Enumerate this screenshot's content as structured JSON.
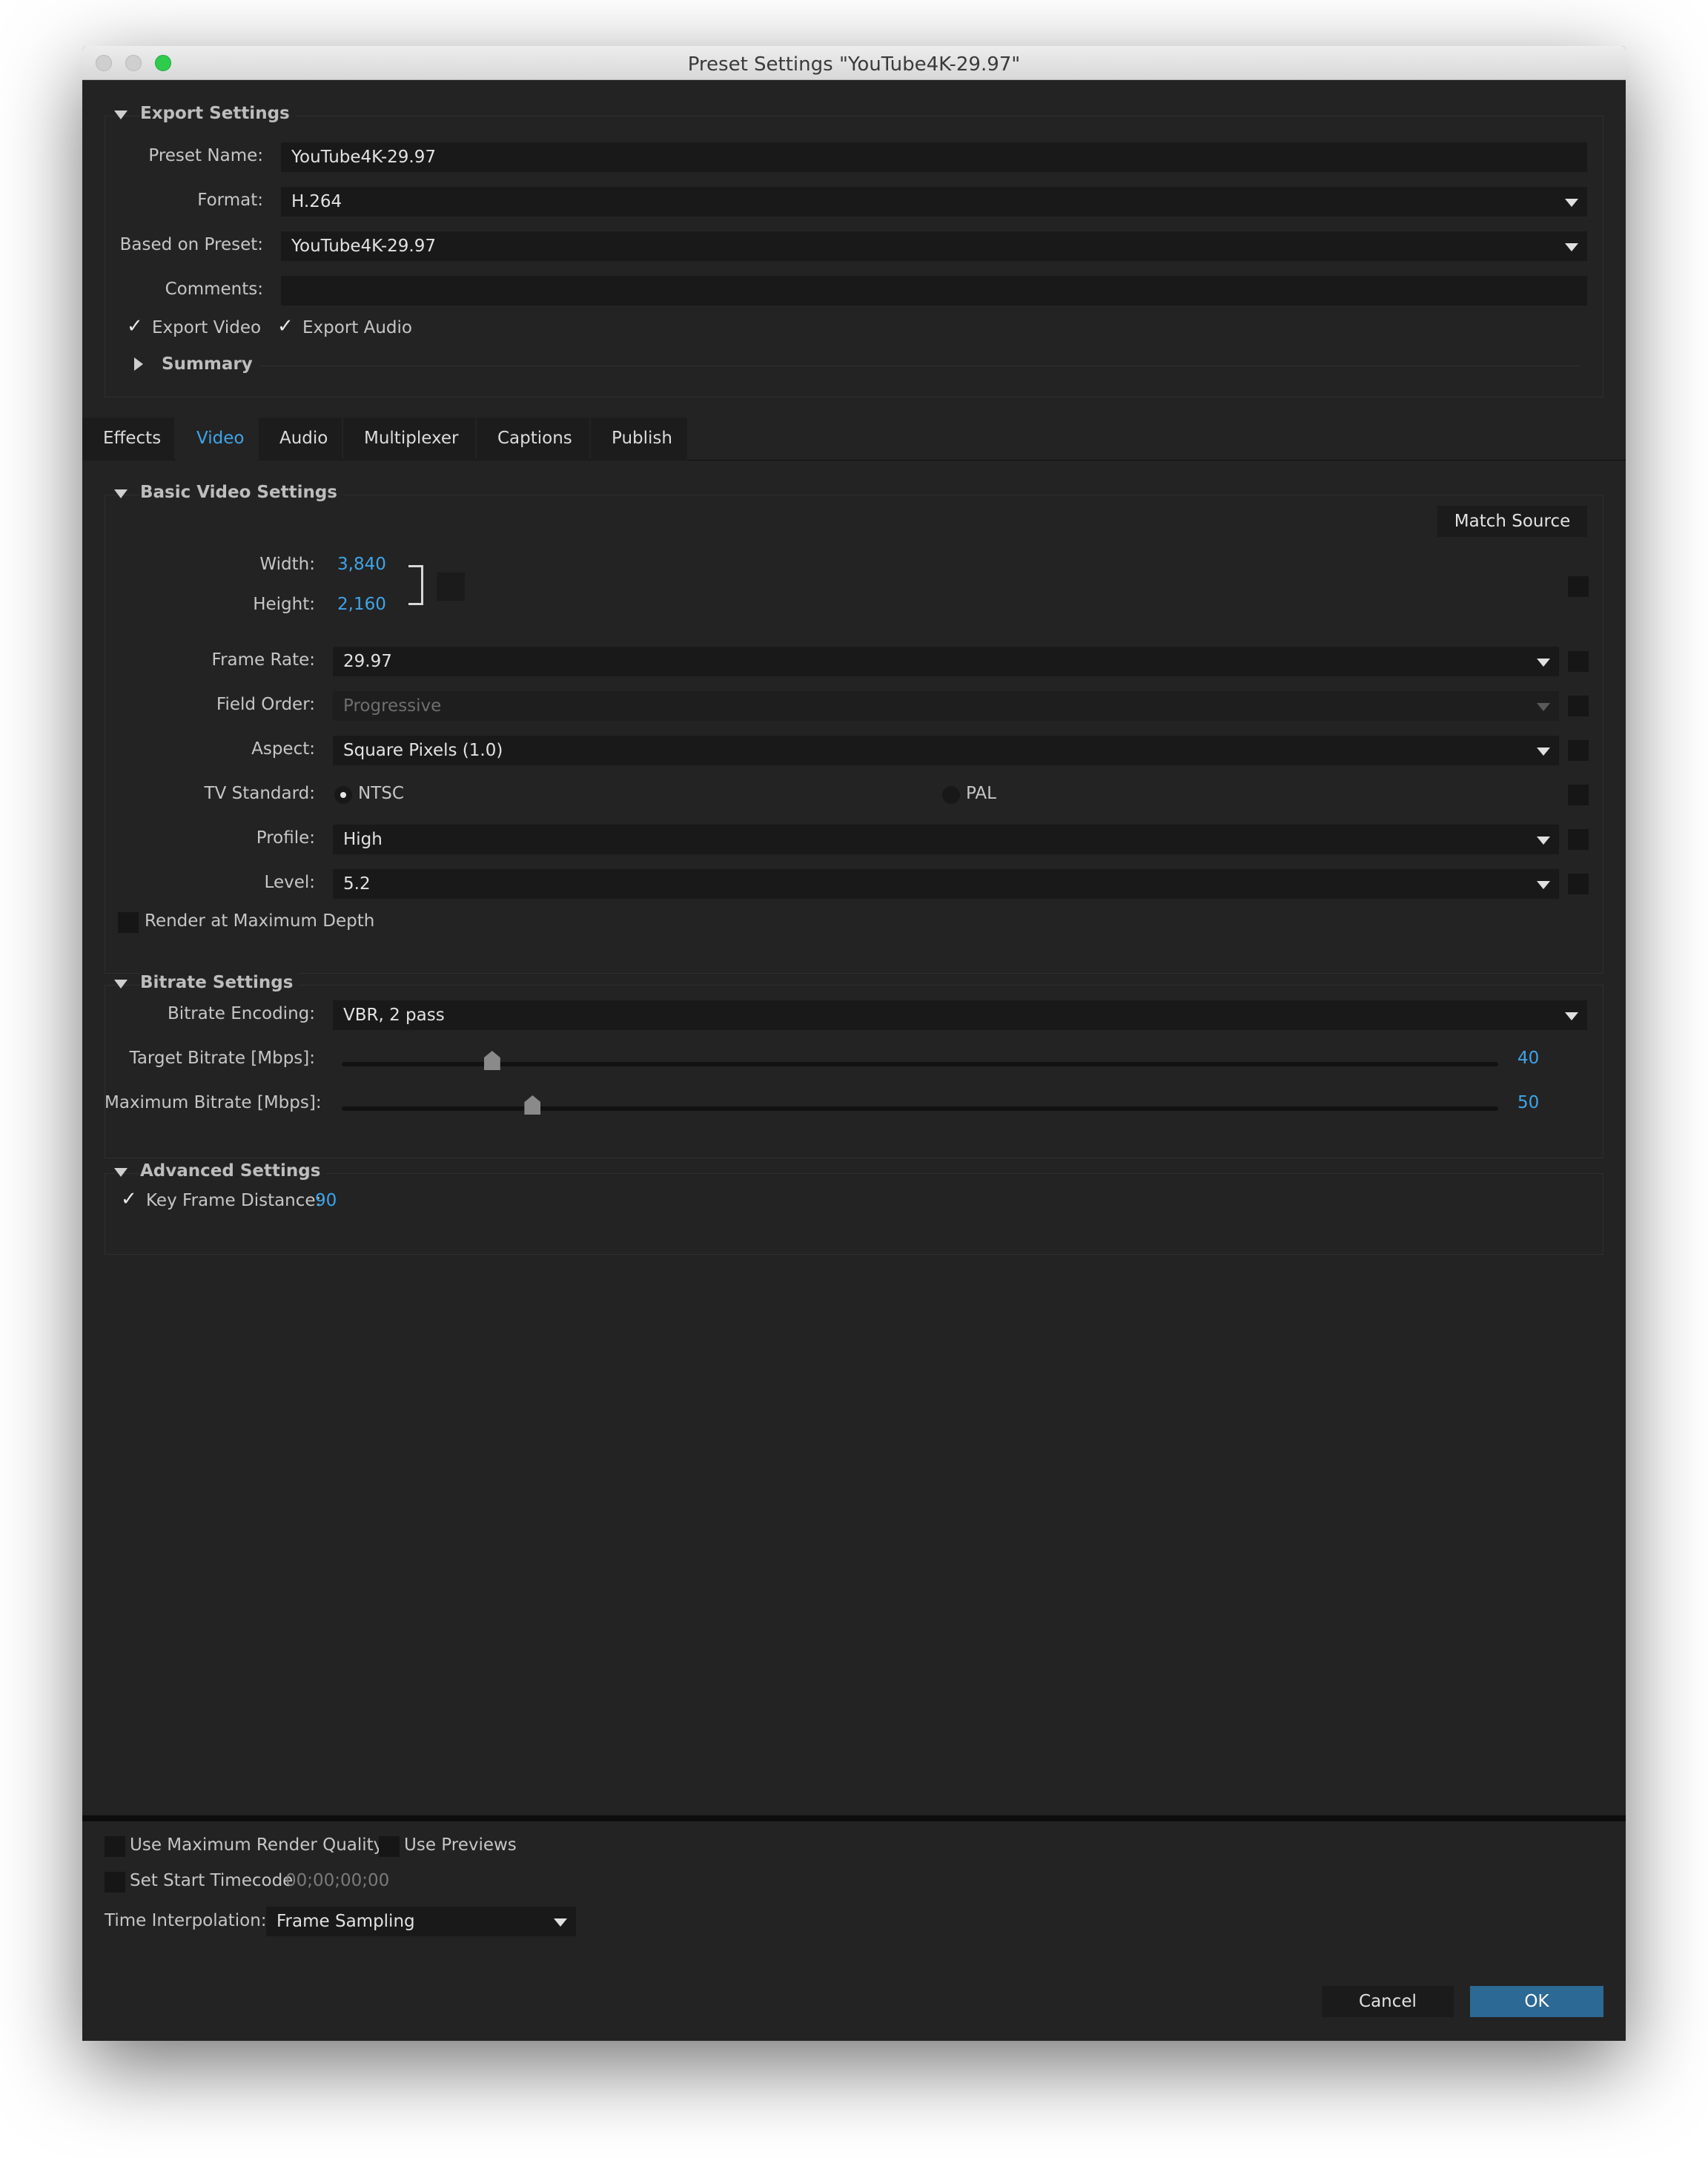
{
  "window": {
    "title": "Preset Settings \"YouTube4K-29.97\""
  },
  "export_settings": {
    "title": "Export Settings",
    "preset_name_label": "Preset Name:",
    "preset_name_value": "YouTube4K-29.97",
    "format_label": "Format:",
    "format_value": "H.264",
    "based_on_label": "Based on Preset:",
    "based_on_value": "YouTube4K-29.97",
    "comments_label": "Comments:",
    "comments_value": "",
    "export_video_label": "Export Video",
    "export_video_checked": true,
    "export_audio_label": "Export Audio",
    "export_audio_checked": true,
    "summary_label": "Summary"
  },
  "tabs": [
    {
      "label": "Effects",
      "active": false
    },
    {
      "label": "Video",
      "active": true
    },
    {
      "label": "Audio",
      "active": false
    },
    {
      "label": "Multiplexer",
      "active": false
    },
    {
      "label": "Captions",
      "active": false
    },
    {
      "label": "Publish",
      "active": false
    }
  ],
  "basic_video": {
    "title": "Basic Video Settings",
    "match_source_label": "Match Source",
    "width_label": "Width:",
    "width_value": "3,840",
    "height_label": "Height:",
    "height_value": "2,160",
    "frame_rate_label": "Frame Rate:",
    "frame_rate_value": "29.97",
    "field_order_label": "Field Order:",
    "field_order_value": "Progressive",
    "aspect_label": "Aspect:",
    "aspect_value": "Square Pixels (1.0)",
    "tv_standard_label": "TV Standard:",
    "tv_ntsc_label": "NTSC",
    "tv_pal_label": "PAL",
    "tv_selected": "NTSC",
    "profile_label": "Profile:",
    "profile_value": "High",
    "level_label": "Level:",
    "level_value": "5.2",
    "render_max_depth_label": "Render at Maximum Depth",
    "render_max_depth_checked": false
  },
  "bitrate": {
    "title": "Bitrate Settings",
    "encoding_label": "Bitrate Encoding:",
    "encoding_value": "VBR, 2 pass",
    "target_label": "Target Bitrate [Mbps]:",
    "target_value": "40",
    "target_fraction": 0.13,
    "max_label": "Maximum Bitrate [Mbps]:",
    "max_value": "50",
    "max_fraction": 0.165
  },
  "advanced": {
    "title": "Advanced Settings",
    "key_frame_label": "Key Frame Distance:",
    "key_frame_value": "90",
    "key_frame_checked": true
  },
  "footer": {
    "max_render_quality_label": "Use Maximum Render Quality",
    "use_previews_label": "Use Previews",
    "set_start_timecode_label": "Set Start Timecode",
    "timecode_value": "00;00;00;00",
    "time_interpolation_label": "Time Interpolation:",
    "time_interpolation_value": "Frame Sampling",
    "cancel_label": "Cancel",
    "ok_label": "OK"
  },
  "colors": {
    "accent": "#3fa4e8",
    "primary_button": "#2c6995",
    "background": "#232323",
    "field": "#191919"
  }
}
